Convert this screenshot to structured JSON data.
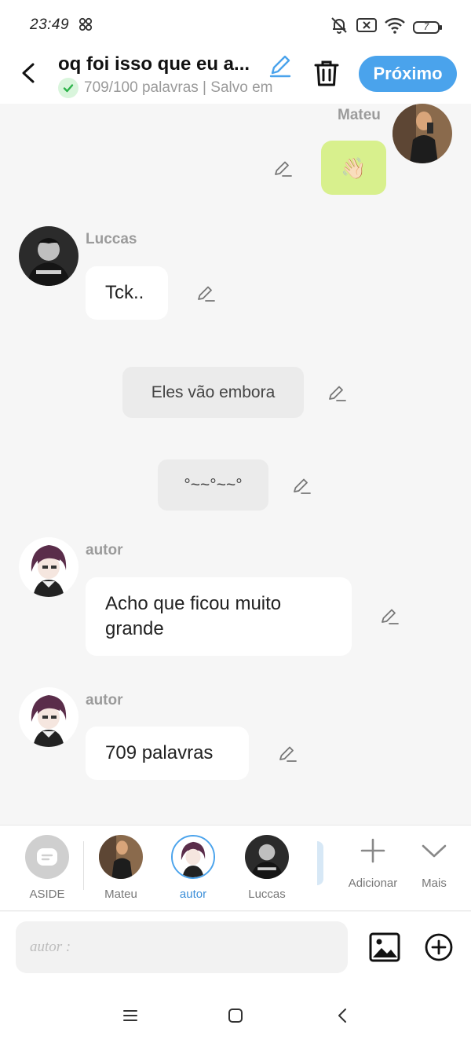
{
  "status_bar": {
    "time": "23:49",
    "battery_level": "7"
  },
  "header": {
    "title": "oq foi isso que eu a...",
    "subtitle": "709/100 palavras | Salvo em",
    "next_label": "Próximo"
  },
  "messages": [
    {
      "speaker": "Mateu",
      "side": "right",
      "text": "👋🏻"
    },
    {
      "speaker": "Luccas",
      "side": "left",
      "text": "Tck.."
    },
    {
      "type": "narration",
      "text": "Eles vão embora"
    },
    {
      "type": "narration",
      "text": "°~~°~~°"
    },
    {
      "speaker": "autor",
      "side": "left",
      "text_line1": "Acho que ficou muito",
      "text_line2": "grande"
    },
    {
      "speaker": "autor",
      "side": "left",
      "text": "709 palavras"
    }
  ],
  "characters": [
    {
      "name": "ASIDE"
    },
    {
      "name": "Mateu"
    },
    {
      "name": "autor",
      "active": true
    },
    {
      "name": "Luccas"
    }
  ],
  "tools": {
    "add_label": "Adicionar",
    "more_label": "Mais"
  },
  "composer": {
    "placeholder": "autor :"
  },
  "colors": {
    "accent": "#4aa3ec",
    "active_character": "#3c8fd8",
    "emoji_bubble": "#d8f08d",
    "saved_check": "#2db34a"
  }
}
